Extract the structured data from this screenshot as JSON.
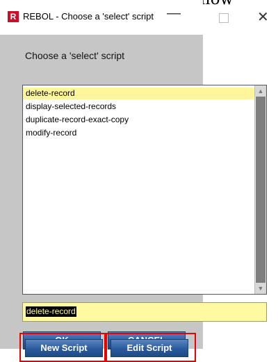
{
  "background": {
    "text": "mation requester for the follow"
  },
  "window": {
    "app_icon_letter": "R",
    "title": "REBOL - Choose a 'select' script",
    "controls": {
      "minimize": "—",
      "maximize": "",
      "close": "✕"
    }
  },
  "dialog": {
    "prompt": "Choose a 'select' script",
    "list": {
      "items": [
        {
          "label": "delete-record",
          "selected": true
        },
        {
          "label": "display-selected-records",
          "selected": false
        },
        {
          "label": "duplicate-record-exact-copy",
          "selected": false
        },
        {
          "label": "modify-record",
          "selected": false
        }
      ]
    },
    "scrollbar": {
      "up": "▲",
      "down": "▼"
    },
    "field_value": "delete-record",
    "buttons": {
      "ok": "OK",
      "cancel": "CANCEL",
      "new_script": "New Script",
      "edit_script": "Edit Script"
    }
  },
  "colors": {
    "selection": "#fff59a",
    "field": "#fffaa2",
    "button": "#2a5a9c",
    "highlight": "#e60000",
    "brand": "#c8102e"
  }
}
